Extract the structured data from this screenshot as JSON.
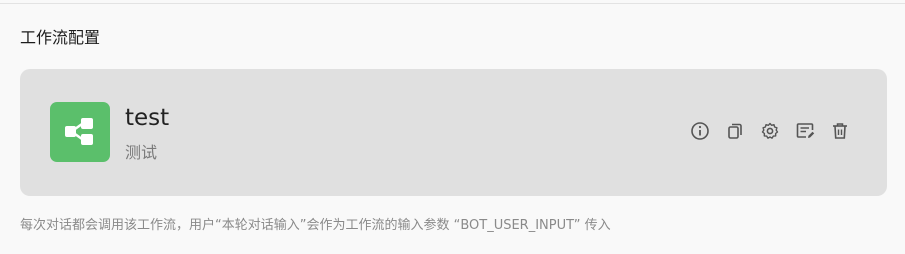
{
  "section": {
    "title": "工作流配置"
  },
  "workflow": {
    "name": "test",
    "description": "测试",
    "icon": "workflow-nodes-icon",
    "icon_color": "#5bbf6b"
  },
  "actions": [
    {
      "name": "info-icon"
    },
    {
      "name": "copy-icon"
    },
    {
      "name": "settings-gear-icon"
    },
    {
      "name": "edit-icon"
    },
    {
      "name": "delete-icon"
    }
  ],
  "footer": {
    "note": "每次对话都会调用该工作流，用户“本轮对话输入”会作为工作流的输入参数 “BOT_USER_INPUT” 传入"
  }
}
